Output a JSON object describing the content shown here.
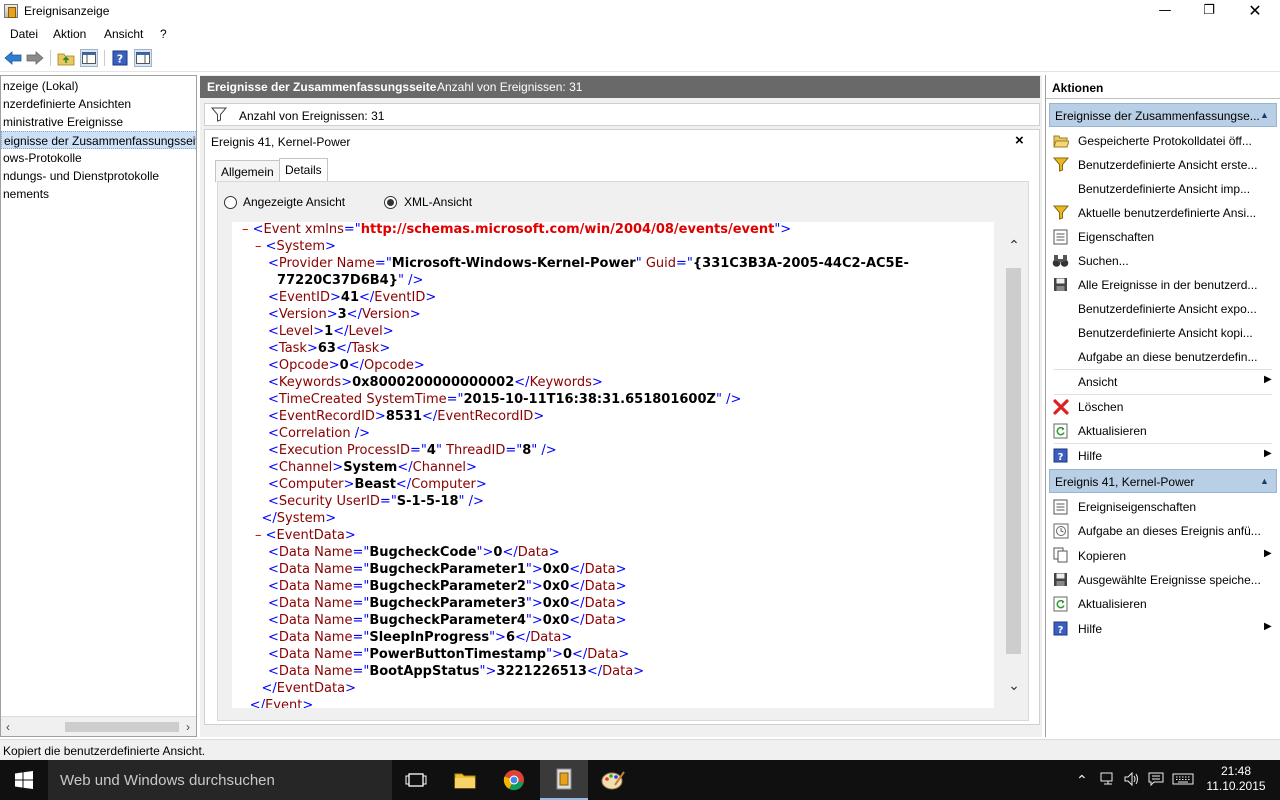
{
  "window": {
    "title": "Ereignisanzeige"
  },
  "menu": [
    "Datei",
    "Aktion",
    "Ansicht",
    "?"
  ],
  "tree": {
    "items": [
      "nzeige (Lokal)",
      "nzerdefinierte Ansichten",
      "ministrative Ereignisse",
      "eignisse der Zusammenfassungsseite",
      "ows-Protokolle",
      "ndungs- und Dienstprotokolle",
      "nements"
    ],
    "selected_index": 3
  },
  "center": {
    "header_title": "Ereignisse der Zusammenfassungsseite",
    "header_count": "Anzahl von Ereignissen: 31",
    "filter_text": "Anzahl von Ereignissen: 31",
    "panel_title": "Ereignis 41, Kernel-Power",
    "close_glyph": "×",
    "tabs": [
      "Allgemein",
      "Details"
    ],
    "active_tab": "Details",
    "radio_friendly": "Angezeigte Ansicht",
    "radio_xml": "XML-Ansicht",
    "selected_view": "XML-Ansicht"
  },
  "xml": [
    {
      "i": 0,
      "t": [
        [
          "m",
          "– "
        ],
        [
          "b",
          "<"
        ],
        [
          "n",
          "Event "
        ],
        [
          "n",
          "xmlns"
        ],
        [
          "b",
          "=\""
        ],
        [
          "u",
          "http://schemas.microsoft.com/win/2004/08/events/event"
        ],
        [
          "b",
          "\">"
        ]
      ]
    },
    {
      "i": 1,
      "t": [
        [
          "m",
          "– "
        ],
        [
          "b",
          "<"
        ],
        [
          "n",
          "System"
        ],
        [
          "b",
          ">"
        ]
      ]
    },
    {
      "i": 2,
      "t": [
        [
          "b",
          "<"
        ],
        [
          "n",
          "Provider "
        ],
        [
          "n",
          "Name"
        ],
        [
          "b",
          "=\""
        ],
        [
          "v",
          "Microsoft-Windows-Kernel-Power"
        ],
        [
          "b",
          "\" "
        ],
        [
          "n",
          "Guid"
        ],
        [
          "b",
          "=\""
        ],
        [
          "v",
          "{331C3B3A-2005-44C2-AC5E-"
        ]
      ]
    },
    {
      "i": 2,
      "t": [
        [
          "v",
          "  77220C37D6B4}"
        ],
        [
          "b",
          "\" />"
        ]
      ]
    },
    {
      "i": 2,
      "t": [
        [
          "b",
          "<"
        ],
        [
          "n",
          "EventID"
        ],
        [
          "b",
          ">"
        ],
        [
          "v",
          "41"
        ],
        [
          "b",
          "</"
        ],
        [
          "n",
          "EventID"
        ],
        [
          "b",
          ">"
        ]
      ]
    },
    {
      "i": 2,
      "t": [
        [
          "b",
          "<"
        ],
        [
          "n",
          "Version"
        ],
        [
          "b",
          ">"
        ],
        [
          "v",
          "3"
        ],
        [
          "b",
          "</"
        ],
        [
          "n",
          "Version"
        ],
        [
          "b",
          ">"
        ]
      ]
    },
    {
      "i": 2,
      "t": [
        [
          "b",
          "<"
        ],
        [
          "n",
          "Level"
        ],
        [
          "b",
          ">"
        ],
        [
          "v",
          "1"
        ],
        [
          "b",
          "</"
        ],
        [
          "n",
          "Level"
        ],
        [
          "b",
          ">"
        ]
      ]
    },
    {
      "i": 2,
      "t": [
        [
          "b",
          "<"
        ],
        [
          "n",
          "Task"
        ],
        [
          "b",
          ">"
        ],
        [
          "v",
          "63"
        ],
        [
          "b",
          "</"
        ],
        [
          "n",
          "Task"
        ],
        [
          "b",
          ">"
        ]
      ]
    },
    {
      "i": 2,
      "t": [
        [
          "b",
          "<"
        ],
        [
          "n",
          "Opcode"
        ],
        [
          "b",
          ">"
        ],
        [
          "v",
          "0"
        ],
        [
          "b",
          "</"
        ],
        [
          "n",
          "Opcode"
        ],
        [
          "b",
          ">"
        ]
      ]
    },
    {
      "i": 2,
      "t": [
        [
          "b",
          "<"
        ],
        [
          "n",
          "Keywords"
        ],
        [
          "b",
          ">"
        ],
        [
          "v",
          "0x8000200000000002"
        ],
        [
          "b",
          "</"
        ],
        [
          "n",
          "Keywords"
        ],
        [
          "b",
          ">"
        ]
      ]
    },
    {
      "i": 2,
      "t": [
        [
          "b",
          "<"
        ],
        [
          "n",
          "TimeCreated "
        ],
        [
          "n",
          "SystemTime"
        ],
        [
          "b",
          "=\""
        ],
        [
          "v",
          "2015-10-11T16:38:31.651801600Z"
        ],
        [
          "b",
          "\" />"
        ]
      ]
    },
    {
      "i": 2,
      "t": [
        [
          "b",
          "<"
        ],
        [
          "n",
          "EventRecordID"
        ],
        [
          "b",
          ">"
        ],
        [
          "v",
          "8531"
        ],
        [
          "b",
          "</"
        ],
        [
          "n",
          "EventRecordID"
        ],
        [
          "b",
          ">"
        ]
      ]
    },
    {
      "i": 2,
      "t": [
        [
          "b",
          "<"
        ],
        [
          "n",
          "Correlation "
        ],
        [
          "b",
          "/>"
        ]
      ]
    },
    {
      "i": 2,
      "t": [
        [
          "b",
          "<"
        ],
        [
          "n",
          "Execution "
        ],
        [
          "n",
          "ProcessID"
        ],
        [
          "b",
          "=\""
        ],
        [
          "v",
          "4"
        ],
        [
          "b",
          "\" "
        ],
        [
          "n",
          "ThreadID"
        ],
        [
          "b",
          "=\""
        ],
        [
          "v",
          "8"
        ],
        [
          "b",
          "\" />"
        ]
      ]
    },
    {
      "i": 2,
      "t": [
        [
          "b",
          "<"
        ],
        [
          "n",
          "Channel"
        ],
        [
          "b",
          ">"
        ],
        [
          "v",
          "System"
        ],
        [
          "b",
          "</"
        ],
        [
          "n",
          "Channel"
        ],
        [
          "b",
          ">"
        ]
      ]
    },
    {
      "i": 2,
      "t": [
        [
          "b",
          "<"
        ],
        [
          "n",
          "Computer"
        ],
        [
          "b",
          ">"
        ],
        [
          "v",
          "Beast"
        ],
        [
          "b",
          "</"
        ],
        [
          "n",
          "Computer"
        ],
        [
          "b",
          ">"
        ]
      ]
    },
    {
      "i": 2,
      "t": [
        [
          "b",
          "<"
        ],
        [
          "n",
          "Security "
        ],
        [
          "n",
          "UserID"
        ],
        [
          "b",
          "=\""
        ],
        [
          "v",
          "S-1-5-18"
        ],
        [
          "b",
          "\" />"
        ]
      ]
    },
    {
      "i": 1.5,
      "t": [
        [
          "b",
          "</"
        ],
        [
          "n",
          "System"
        ],
        [
          "b",
          ">"
        ]
      ]
    },
    {
      "i": 1,
      "t": [
        [
          "m",
          "– "
        ],
        [
          "b",
          "<"
        ],
        [
          "n",
          "EventData"
        ],
        [
          "b",
          ">"
        ]
      ]
    },
    {
      "i": 2,
      "t": [
        [
          "b",
          "<"
        ],
        [
          "n",
          "Data "
        ],
        [
          "n",
          "Name"
        ],
        [
          "b",
          "=\""
        ],
        [
          "v",
          "BugcheckCode"
        ],
        [
          "b",
          "\">"
        ],
        [
          "v",
          "0"
        ],
        [
          "b",
          "</"
        ],
        [
          "n",
          "Data"
        ],
        [
          "b",
          ">"
        ]
      ]
    },
    {
      "i": 2,
      "t": [
        [
          "b",
          "<"
        ],
        [
          "n",
          "Data "
        ],
        [
          "n",
          "Name"
        ],
        [
          "b",
          "=\""
        ],
        [
          "v",
          "BugcheckParameter1"
        ],
        [
          "b",
          "\">"
        ],
        [
          "v",
          "0x0"
        ],
        [
          "b",
          "</"
        ],
        [
          "n",
          "Data"
        ],
        [
          "b",
          ">"
        ]
      ]
    },
    {
      "i": 2,
      "t": [
        [
          "b",
          "<"
        ],
        [
          "n",
          "Data "
        ],
        [
          "n",
          "Name"
        ],
        [
          "b",
          "=\""
        ],
        [
          "v",
          "BugcheckParameter2"
        ],
        [
          "b",
          "\">"
        ],
        [
          "v",
          "0x0"
        ],
        [
          "b",
          "</"
        ],
        [
          "n",
          "Data"
        ],
        [
          "b",
          ">"
        ]
      ]
    },
    {
      "i": 2,
      "t": [
        [
          "b",
          "<"
        ],
        [
          "n",
          "Data "
        ],
        [
          "n",
          "Name"
        ],
        [
          "b",
          "=\""
        ],
        [
          "v",
          "BugcheckParameter3"
        ],
        [
          "b",
          "\">"
        ],
        [
          "v",
          "0x0"
        ],
        [
          "b",
          "</"
        ],
        [
          "n",
          "Data"
        ],
        [
          "b",
          ">"
        ]
      ]
    },
    {
      "i": 2,
      "t": [
        [
          "b",
          "<"
        ],
        [
          "n",
          "Data "
        ],
        [
          "n",
          "Name"
        ],
        [
          "b",
          "=\""
        ],
        [
          "v",
          "BugcheckParameter4"
        ],
        [
          "b",
          "\">"
        ],
        [
          "v",
          "0x0"
        ],
        [
          "b",
          "</"
        ],
        [
          "n",
          "Data"
        ],
        [
          "b",
          ">"
        ]
      ]
    },
    {
      "i": 2,
      "t": [
        [
          "b",
          "<"
        ],
        [
          "n",
          "Data "
        ],
        [
          "n",
          "Name"
        ],
        [
          "b",
          "=\""
        ],
        [
          "v",
          "SleepInProgress"
        ],
        [
          "b",
          "\">"
        ],
        [
          "v",
          "6"
        ],
        [
          "b",
          "</"
        ],
        [
          "n",
          "Data"
        ],
        [
          "b",
          ">"
        ]
      ]
    },
    {
      "i": 2,
      "t": [
        [
          "b",
          "<"
        ],
        [
          "n",
          "Data "
        ],
        [
          "n",
          "Name"
        ],
        [
          "b",
          "=\""
        ],
        [
          "v",
          "PowerButtonTimestamp"
        ],
        [
          "b",
          "\">"
        ],
        [
          "v",
          "0"
        ],
        [
          "b",
          "</"
        ],
        [
          "n",
          "Data"
        ],
        [
          "b",
          ">"
        ]
      ]
    },
    {
      "i": 2,
      "t": [
        [
          "b",
          "<"
        ],
        [
          "n",
          "Data "
        ],
        [
          "n",
          "Name"
        ],
        [
          "b",
          "=\""
        ],
        [
          "v",
          "BootAppStatus"
        ],
        [
          "b",
          "\">"
        ],
        [
          "v",
          "3221226513"
        ],
        [
          "b",
          "</"
        ],
        [
          "n",
          "Data"
        ],
        [
          "b",
          ">"
        ]
      ]
    },
    {
      "i": 1.5,
      "t": [
        [
          "b",
          "</"
        ],
        [
          "n",
          "EventData"
        ],
        [
          "b",
          ">"
        ]
      ]
    },
    {
      "i": 0.6,
      "t": [
        [
          "b",
          "</"
        ],
        [
          "n",
          "Event"
        ],
        [
          "b",
          ">"
        ]
      ]
    }
  ],
  "actions": {
    "header": "Aktionen",
    "section1": {
      "title": "Ereignisse der Zusammenfassungse...",
      "items": [
        {
          "icon": "folder-open-icon",
          "label": "Gespeicherte Protokolldatei öff...",
          "sub": false
        },
        {
          "icon": "filter-icon",
          "label": "Benutzerdefinierte Ansicht erste...",
          "sub": false
        },
        {
          "icon": "none",
          "label": "Benutzerdefinierte Ansicht imp...",
          "sub": false
        },
        {
          "icon": "filter-icon",
          "label": "Aktuelle benutzerdefinierte Ansi...",
          "sub": false
        },
        {
          "icon": "properties-icon",
          "label": "Eigenschaften",
          "sub": false
        },
        {
          "icon": "binoculars-icon",
          "label": "Suchen...",
          "sub": false
        },
        {
          "icon": "save-icon",
          "label": "Alle Ereignisse in der benutzerd...",
          "sub": false
        },
        {
          "icon": "none",
          "label": "Benutzerdefinierte Ansicht expo...",
          "sub": false
        },
        {
          "icon": "none",
          "label": "Benutzerdefinierte Ansicht kopi...",
          "sub": false
        },
        {
          "icon": "none",
          "label": "Aufgabe an diese benutzerdefin...",
          "sub": false
        },
        {
          "icon": "none",
          "label": "Ansicht",
          "sub": true
        },
        {
          "icon": "delete-icon",
          "label": "Löschen",
          "sub": false
        },
        {
          "icon": "refresh-icon",
          "label": "Aktualisieren",
          "sub": false
        },
        {
          "icon": "help-icon",
          "label": "Hilfe",
          "sub": true
        }
      ]
    },
    "section2": {
      "title": "Ereignis 41, Kernel-Power",
      "items": [
        {
          "icon": "properties-icon",
          "label": "Ereigniseigenschaften",
          "sub": false
        },
        {
          "icon": "task-icon",
          "label": "Aufgabe an dieses Ereignis anfü...",
          "sub": false
        },
        {
          "icon": "copy-icon",
          "label": "Kopieren",
          "sub": true
        },
        {
          "icon": "save-icon",
          "label": "Ausgewählte Ereignisse speiche...",
          "sub": false
        },
        {
          "icon": "refresh-icon",
          "label": "Aktualisieren",
          "sub": false
        },
        {
          "icon": "help-icon",
          "label": "Hilfe",
          "sub": true
        }
      ]
    }
  },
  "status": "Kopiert die benutzerdefinierte Ansicht.",
  "taskbar": {
    "search_placeholder": "Web und Windows durchsuchen",
    "time": "21:48",
    "date": "11.10.2015"
  }
}
